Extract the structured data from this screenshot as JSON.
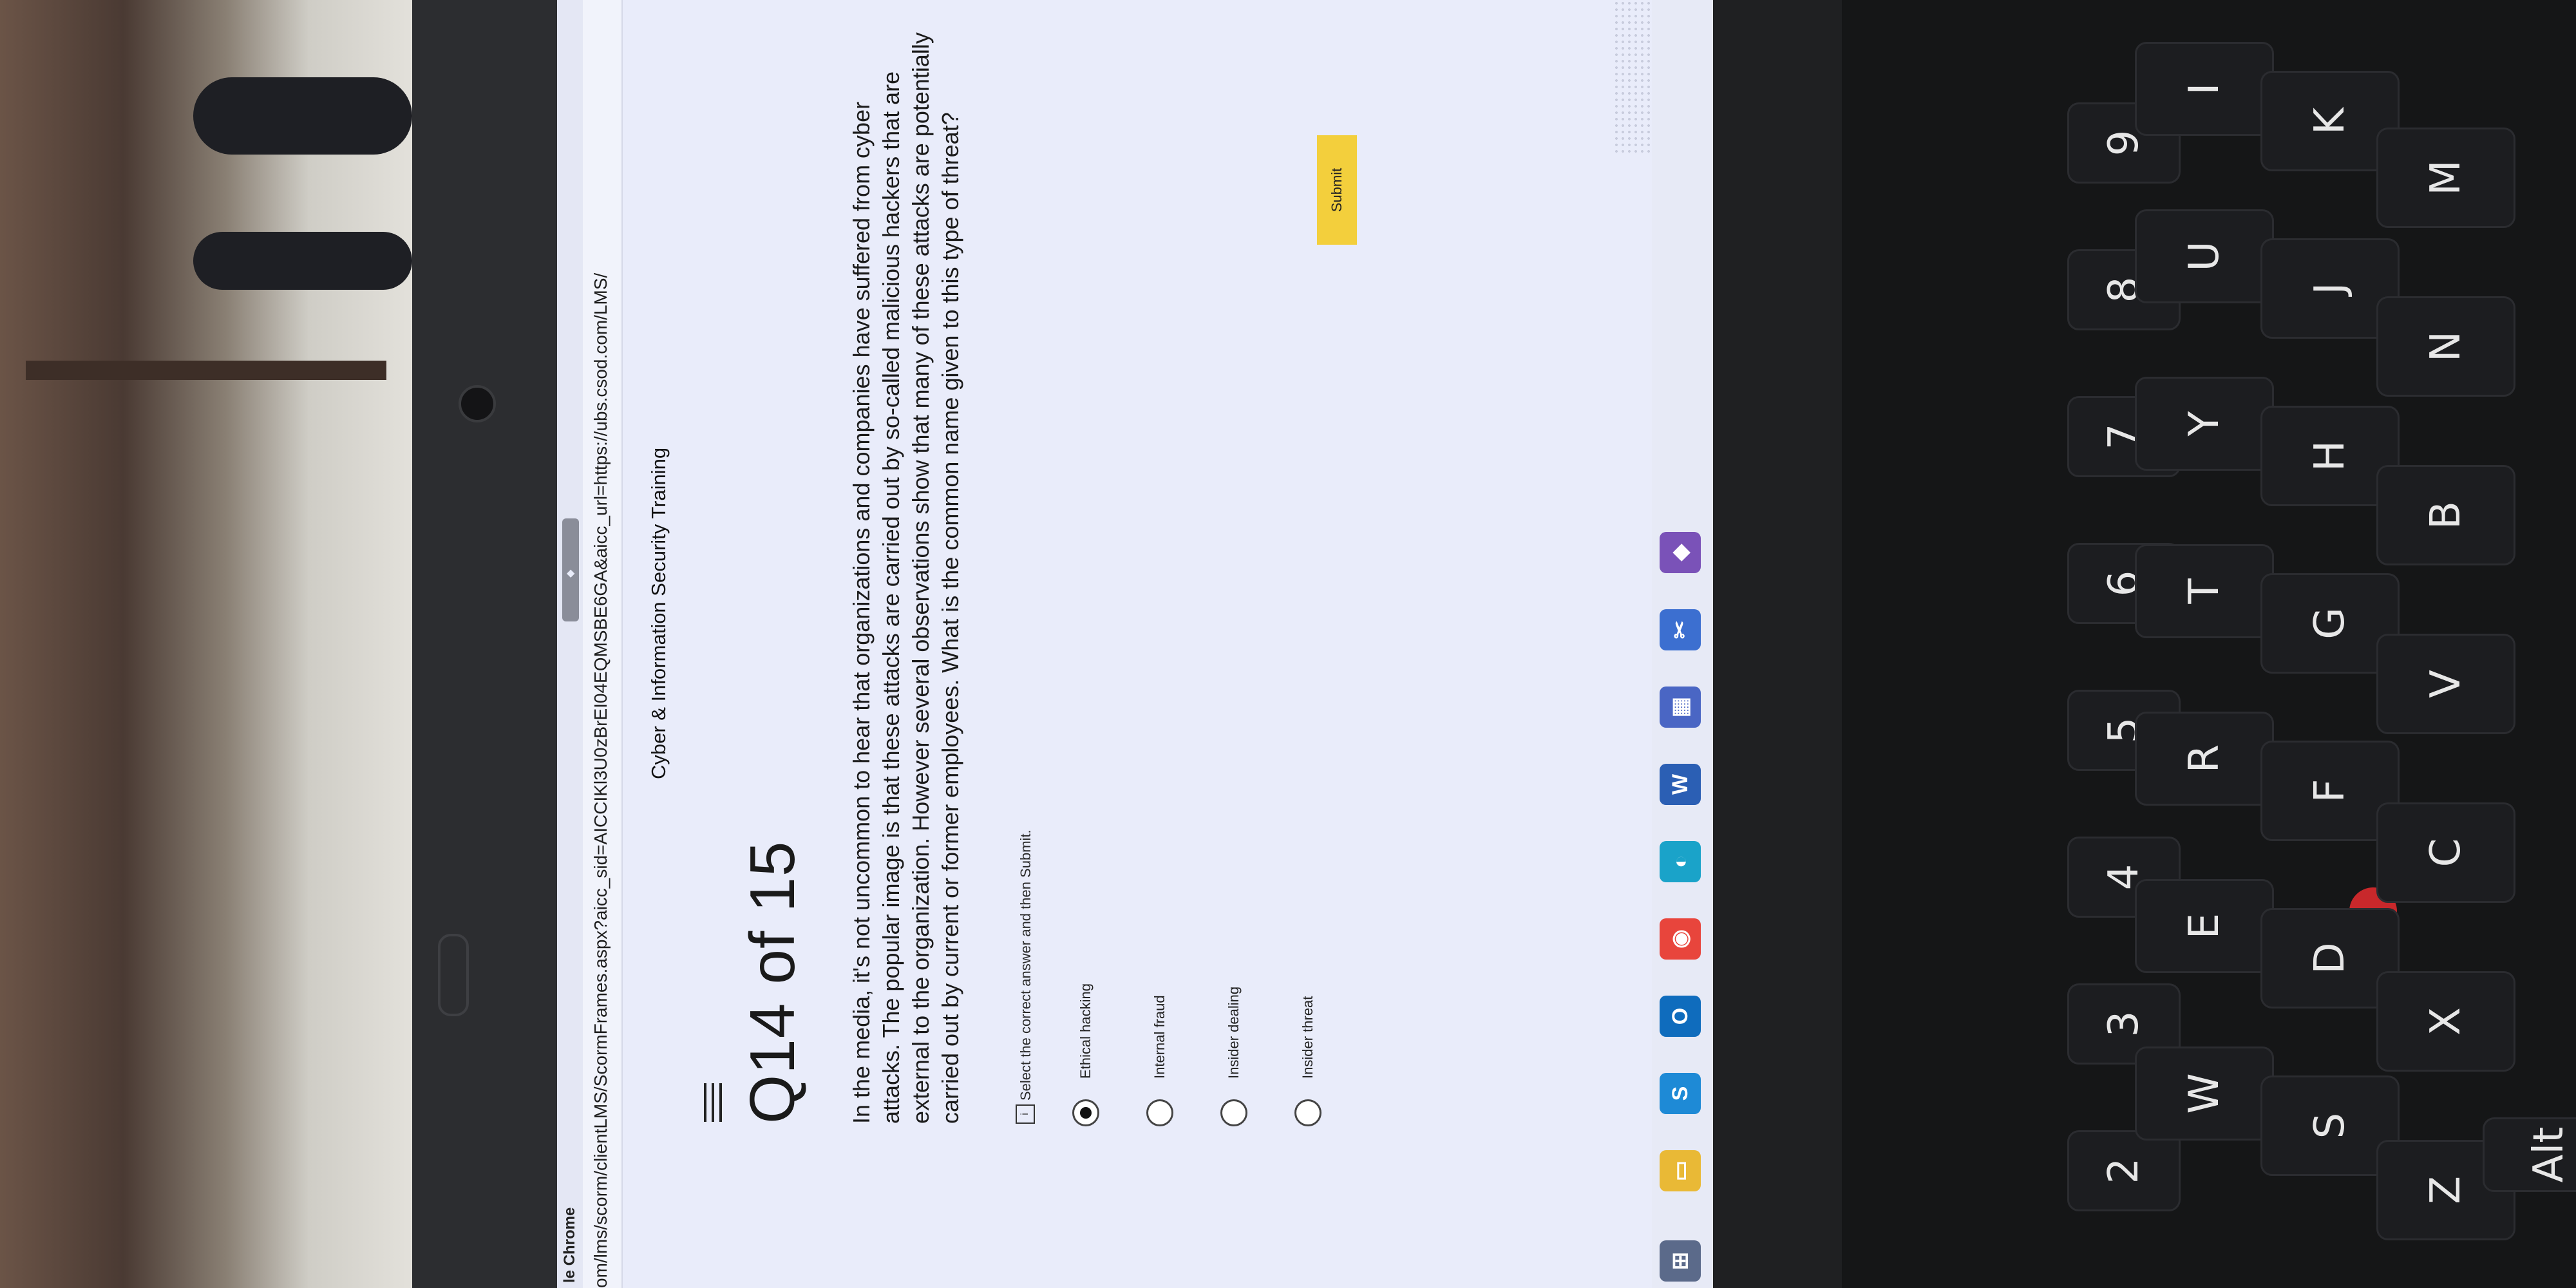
{
  "browser": {
    "app_title": "le Chrome",
    "url": "om/lms/scorm/clientLMS/ScormFrames.aspx?aicc_sid=AICCIKl3U0zBrEI04EQMSBE6GA&aicc_url=https://ubs.csod.com/LMS/"
  },
  "course": {
    "title": "Cyber & Information Security Training",
    "question_number": "Q14 of 15",
    "question_text": "In the media, it's not uncommon to hear that organizations and companies have suffered from cyber attacks. The popular image is that these attacks are carried out by so-called malicious hackers that are external to the organization. However several observations show that many of these attacks are potentially carried out by current or former employees. What is the common name given to this type of threat?",
    "instruction": "Select the correct answer and then Submit.",
    "options": [
      {
        "label": "Ethical hacking",
        "selected": true
      },
      {
        "label": "Internal fraud",
        "selected": false
      },
      {
        "label": "Insider dealing",
        "selected": false
      },
      {
        "label": "Insider threat",
        "selected": false
      }
    ],
    "submit_label": "Submit"
  },
  "taskbar": {
    "icons": [
      "widgets-icon",
      "file-explorer-icon",
      "skype-icon",
      "outlook-icon",
      "chrome-icon",
      "edge-icon",
      "word-icon",
      "teams-icon",
      "snipping-icon",
      "remote-icon"
    ]
  },
  "keyboard": {
    "number_row": [
      "2",
      "3",
      "4",
      "5",
      "6",
      "7",
      "8",
      "9"
    ],
    "number_row_shift": [
      "@",
      "#",
      "$",
      "%",
      "^",
      "&",
      "*",
      "("
    ],
    "top_row": [
      "W",
      "E",
      "R",
      "T",
      "Y",
      "U",
      "I"
    ],
    "home_row": [
      "S",
      "D",
      "F",
      "G",
      "H",
      "J",
      "K"
    ],
    "bottom_row": [
      "Z",
      "X",
      "C",
      "V",
      "B",
      "N",
      "M"
    ],
    "modifier": "Alt"
  },
  "colors": {
    "submit": "#f3cf3c",
    "screen_bg": "#e9ecfa",
    "trackpoint": "#c8282b"
  }
}
